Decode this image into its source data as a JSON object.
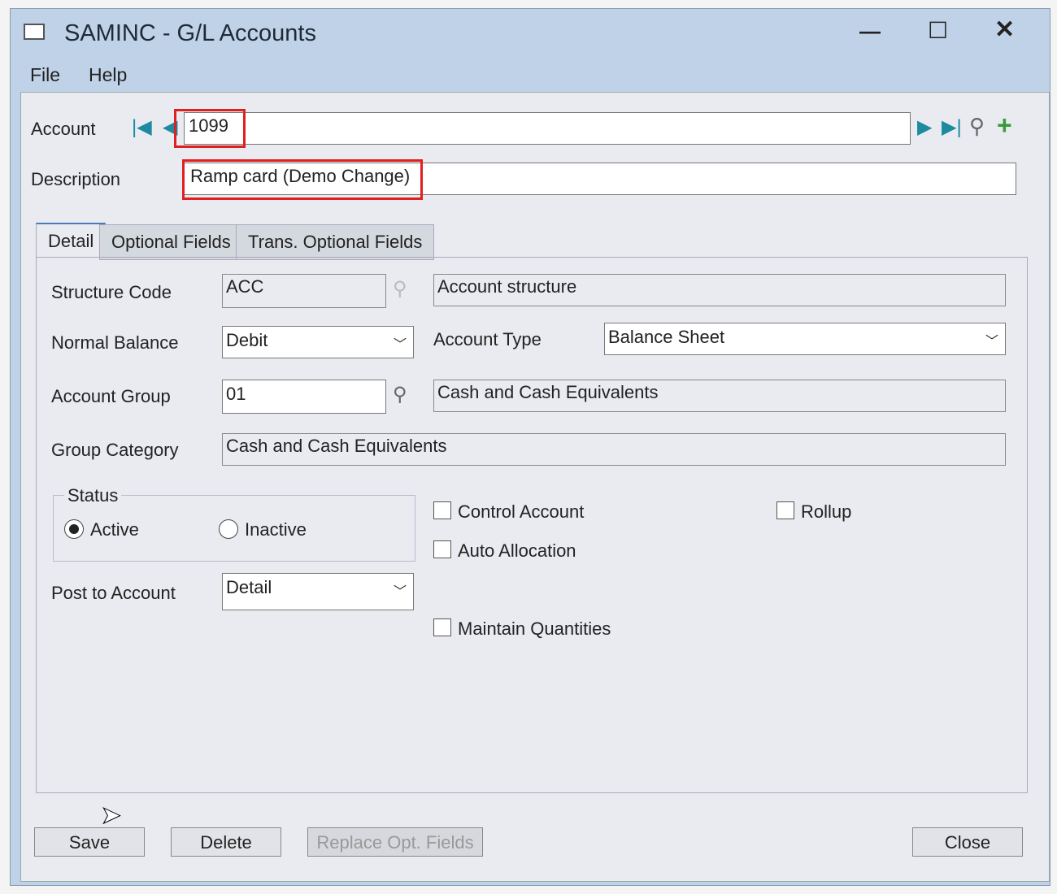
{
  "window": {
    "title": "SAMINC - G/L Accounts",
    "minimize": "—",
    "maximize": "☐",
    "close": "✕"
  },
  "menu": [
    "File",
    "Help"
  ],
  "account": {
    "label": "Account",
    "value": "1099"
  },
  "description": {
    "label": "Description",
    "value": "Ramp card (Demo Change)"
  },
  "tabs": [
    "Detail",
    "Optional Fields",
    "Trans. Optional Fields"
  ],
  "detail": {
    "structure_code": {
      "label": "Structure Code",
      "value": "ACC",
      "desc": "Account structure"
    },
    "normal_balance": {
      "label": "Normal Balance",
      "value": "Debit"
    },
    "account_type": {
      "label": "Account Type",
      "value": "Balance Sheet"
    },
    "account_group": {
      "label": "Account Group",
      "value": "01",
      "desc": "Cash and Cash Equivalents"
    },
    "group_category": {
      "label": "Group Category",
      "value": "Cash and Cash Equivalents"
    },
    "status": {
      "label": "Status",
      "active": "Active",
      "inactive": "Inactive",
      "selected": "Active"
    },
    "post_to_account": {
      "label": "Post to Account",
      "value": "Detail"
    },
    "control_account": "Control Account",
    "rollup": "Rollup",
    "auto_allocation": "Auto Allocation",
    "maintain_quantities": "Maintain Quantities"
  },
  "buttons": {
    "save": "Save",
    "delete": "Delete",
    "replace": "Replace Opt. Fields",
    "close": "Close"
  }
}
